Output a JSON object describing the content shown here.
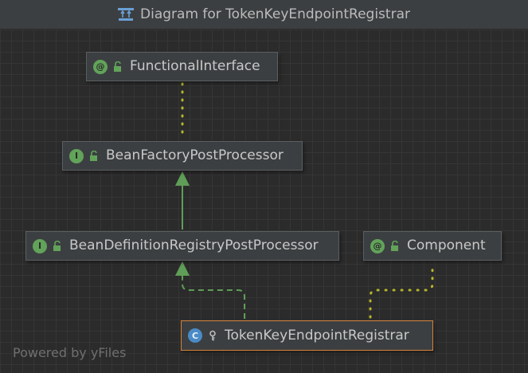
{
  "window": {
    "title": "Diagram for TokenKeyEndpointRegistrar",
    "title_icon": "diagram-icon"
  },
  "nodes": [
    {
      "id": "functional-interface",
      "kind": "annotation",
      "kind_letter": "@",
      "visibility_icon": "unlocked-icon",
      "label": "FunctionalInterface"
    },
    {
      "id": "bean-factory-post-processor",
      "kind": "interface",
      "kind_letter": "I",
      "visibility_icon": "unlocked-icon",
      "label": "BeanFactoryPostProcessor"
    },
    {
      "id": "bean-definition-registry-post-processor",
      "kind": "interface",
      "kind_letter": "I",
      "visibility_icon": "unlocked-icon",
      "label": "BeanDefinitionRegistryPostProcessor"
    },
    {
      "id": "component",
      "kind": "annotation",
      "kind_letter": "@",
      "visibility_icon": "unlocked-icon",
      "label": "Component"
    },
    {
      "id": "token-key-endpoint-registrar",
      "kind": "class",
      "kind_letter": "C",
      "visibility_icon": "key-icon",
      "label": "TokenKeyEndpointRegistrar",
      "selected": true
    }
  ],
  "edges": [
    {
      "from": "bean-factory-post-processor",
      "to": "functional-interface",
      "type": "annotation",
      "style": "dotted"
    },
    {
      "from": "bean-definition-registry-post-processor",
      "to": "bean-factory-post-processor",
      "type": "extends",
      "style": "solid"
    },
    {
      "from": "token-key-endpoint-registrar",
      "to": "bean-definition-registry-post-processor",
      "type": "implements",
      "style": "dashed"
    },
    {
      "from": "token-key-endpoint-registrar",
      "to": "component",
      "type": "annotation",
      "style": "dotted"
    }
  ],
  "colors": {
    "background": "#2b2b2b",
    "node_fill": "#3c3f41",
    "node_border": "#5b5f61",
    "selected_border": "#d4823a",
    "inheritance_edge": "#5f9e57",
    "annotation_edge": "#b5b52a",
    "badge_green": "#62a35a",
    "badge_blue": "#4a8bc7"
  },
  "footer": {
    "text": "Powered by yFiles"
  }
}
